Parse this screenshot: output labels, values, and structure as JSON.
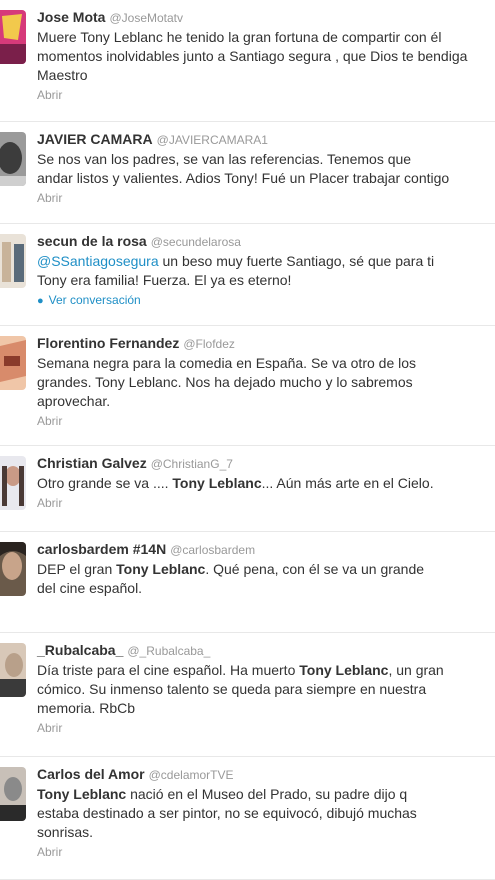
{
  "tweets": [
    {
      "name": "Jose Mota",
      "handle": "@JoseMotatv",
      "lines": [
        "Muere Tony Leblanc he tenido la gran fortuna de compartir con él",
        "momentos inolvidables junto a Santiago segura , que Dios te bendiga",
        "Maestro"
      ],
      "action": "Abrir",
      "avatar_colors": [
        "#d63a7a",
        "#f2c94c",
        "#7a1f4a"
      ]
    },
    {
      "name": "JAVIER CAMARA",
      "handle": "@JAVIERCAMARA1",
      "lines": [
        "Se nos van los padres, se van las referencias. Tenemos que",
        "andar listos y valientes. Adios Tony! Fué un Placer trabajar contigo"
      ],
      "action": "Abrir",
      "avatar_colors": [
        "#9a9a9a",
        "#3c3c3c",
        "#cfcfcf"
      ]
    },
    {
      "name": "secun de la rosa",
      "handle": "@secundelarosa",
      "mention": "@SSantiagosegura",
      "line1_rest": " un beso muy fuerte Santiago, sé que para ti",
      "line2": "Tony era familia! Fuerza. El ya es eterno!",
      "action": "Ver conversación",
      "avatar_colors": [
        "#c8b39a",
        "#5a6b7a",
        "#e9e2d8"
      ]
    },
    {
      "name": "Florentino Fernandez",
      "handle": "@Flofdez",
      "lines": [
        "Semana negra para la comedia en España. Se va otro de los",
        "grandes. Tony Leblanc. Nos ha dejado mucho y lo sabremos",
        "aprovechar."
      ],
      "action": "Abrir",
      "avatar_colors": [
        "#d88b6b",
        "#8a3b2b",
        "#f0c6a8"
      ]
    },
    {
      "name": "Christian Galvez",
      "handle": "@ChristianG_7",
      "line1_before": "Otro grande se va .... ",
      "line1_bold": "Tony Leblanc",
      "line1_after": "... Aún más arte en el Cielo.",
      "action": "Abrir",
      "avatar_colors": [
        "#e8e8ee",
        "#4a3a36",
        "#c99a86"
      ]
    },
    {
      "name": "carlosbardem #14N",
      "handle": "@carlosbardem",
      "line1_before": "DEP el gran ",
      "line1_bold": "Tony Leblanc",
      "line1_after": ". Qué pena, con él se va un grande",
      "line2": "del cine español.",
      "action": "",
      "avatar_colors": [
        "#6a5a4a",
        "#2a2420",
        "#c8a48a"
      ]
    },
    {
      "name": "_Rubalcaba_",
      "handle": "@_Rubalcaba_",
      "line1_before": "Día triste para el cine español. Ha muerto ",
      "line1_bold": "Tony Leblanc",
      "line1_after": ", un gran",
      "line2": "cómico. Su inmenso talento se queda para siempre en nuestra",
      "line3": "memoria. RbCb",
      "action": "Abrir",
      "avatar_colors": [
        "#b8a08a",
        "#3a3a3a",
        "#d8c8b8"
      ]
    },
    {
      "name": "Carlos del Amor",
      "handle": "@cdelamorTVE",
      "line1_bold": "Tony Leblanc",
      "line1_after": " nació en el Museo del Prado, su padre dijo q",
      "line2": "estaba destinado a ser pintor, no se equivocó, dibujó muchas",
      "line3": "sonrisas.",
      "action": "Abrir",
      "avatar_colors": [
        "#8a8a8a",
        "#2a2a2a",
        "#c8c0b8"
      ]
    }
  ]
}
